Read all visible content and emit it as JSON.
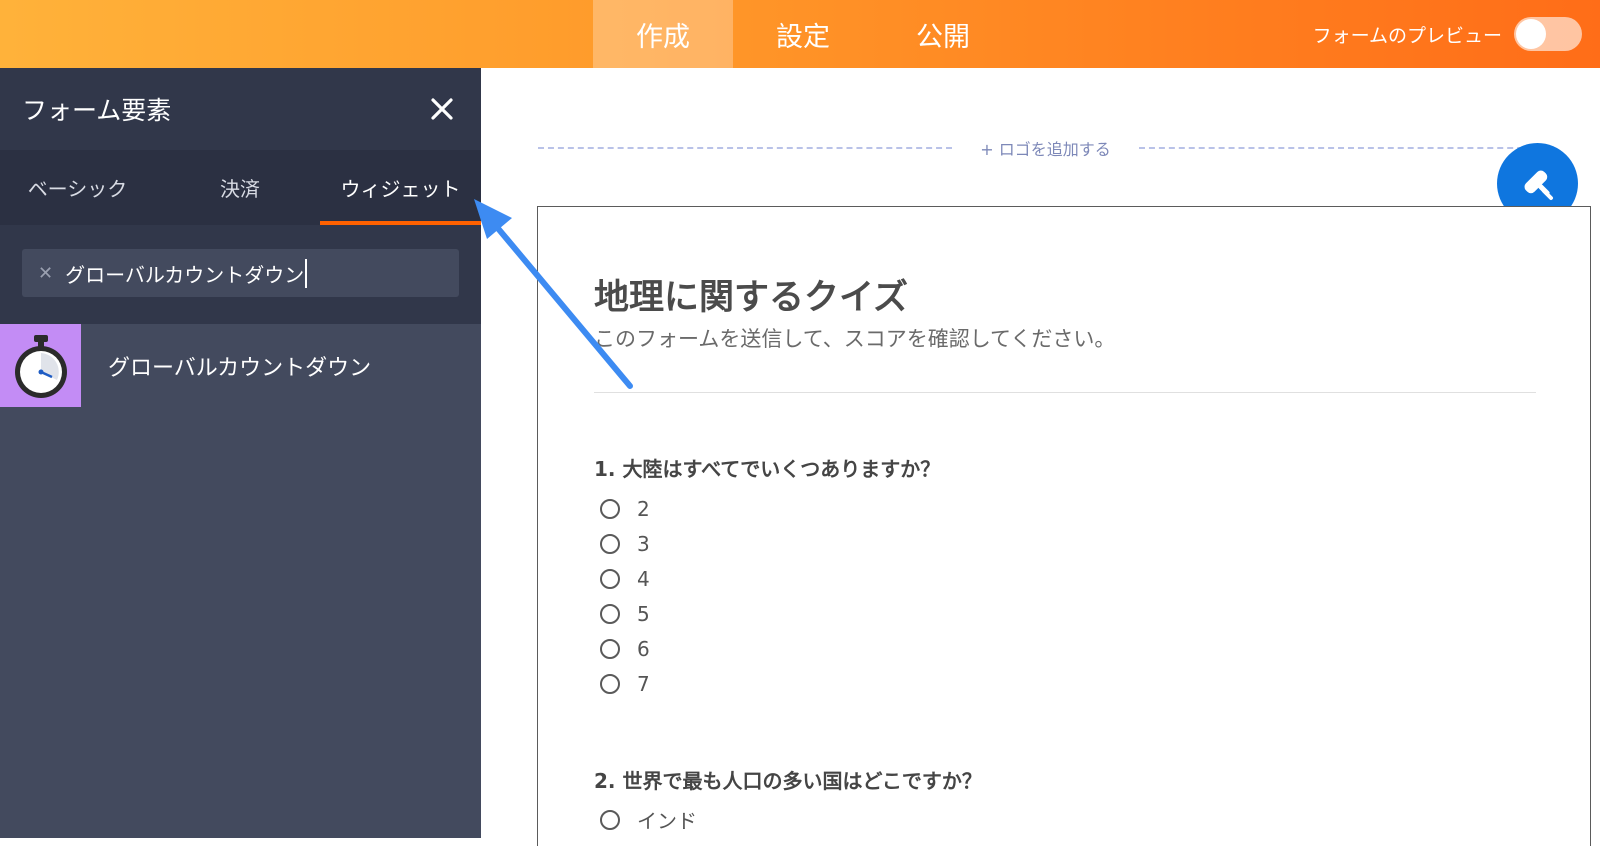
{
  "topbar": {
    "tabs": [
      {
        "label": "作成",
        "active": true
      },
      {
        "label": "設定",
        "active": false
      },
      {
        "label": "公開",
        "active": false
      }
    ],
    "preview_label": "フォームのプレビュー",
    "preview_toggle_on": false
  },
  "sidebar": {
    "title": "フォーム要素",
    "close_icon": "close-icon",
    "tabs": [
      {
        "label": "ベーシック"
      },
      {
        "label": "決済"
      },
      {
        "label": "ウィジェット",
        "active": true
      }
    ],
    "search": {
      "value": "グローバルカウントダウン",
      "clear_icon": "clear-icon"
    },
    "results": [
      {
        "label": "グローバルカウントダウン",
        "icon": "stopwatch-icon"
      }
    ]
  },
  "content": {
    "add_logo": "+ ロゴを追加する",
    "fab_icon": "paint-roller-icon",
    "form": {
      "title": "地理に関するクイズ",
      "subtitle": "このフォームを送信して、スコアを確認してください。",
      "questions": [
        {
          "label": "1. 大陸はすべてでいくつありますか？",
          "options": [
            "2",
            "3",
            "4",
            "5",
            "6",
            "7"
          ]
        },
        {
          "label": "2. 世界で最も人口の多い国はどこですか？",
          "options": [
            "インド"
          ]
        }
      ]
    }
  },
  "colors": {
    "topbar_start": "#ffb23a",
    "topbar_end": "#ff6d18",
    "sidebar_bg": "#434a5e",
    "tab_underline": "#ff6100",
    "fab": "#0f76df",
    "annotation_arrow": "#3d8bf2",
    "widget_thumb": "#c38cf5"
  }
}
